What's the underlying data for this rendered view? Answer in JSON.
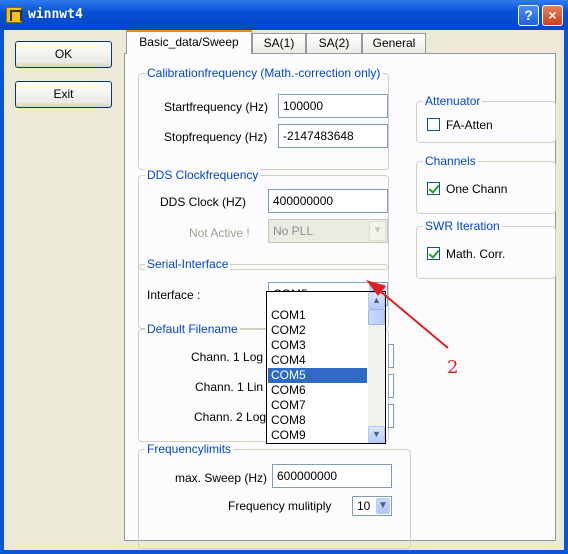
{
  "window": {
    "title": "winnwt4",
    "help_label": "?",
    "close_label": "×"
  },
  "buttons": {
    "ok": "OK",
    "exit": "Exit"
  },
  "tabs": [
    {
      "label": "Basic_data/Sweep",
      "active": true
    },
    {
      "label": "SA(1)",
      "active": false
    },
    {
      "label": "SA(2)",
      "active": false
    },
    {
      "label": "General",
      "active": false
    }
  ],
  "calibration": {
    "title": "Calibrationfrequency (Math.-correction only)",
    "start_label": "Startfrequency (Hz)",
    "start_value": "100000",
    "stop_label": "Stopfrequency (Hz)",
    "stop_value": "-2147483648"
  },
  "dds": {
    "title": "DDS Clockfrequency",
    "clock_label": "DDS Clock (HZ)",
    "clock_value": "400000000",
    "pll_label": "Not Active !",
    "pll_value": "No PLL"
  },
  "serial": {
    "title": "Serial-Interface",
    "interface_label": "Interface :",
    "interface_value": "COM5",
    "options": [
      "COM1",
      "COM2",
      "COM3",
      "COM4",
      "COM5",
      "COM6",
      "COM7",
      "COM8",
      "COM9"
    ],
    "selected_index": 4
  },
  "default_filename": {
    "title": "Default Filename",
    "chann1_log": "Chann. 1  Log",
    "chann1_lin": "Chann. 1  Lin",
    "chann2_log": "Chann. 2 Log"
  },
  "frequencylimits": {
    "title": "Frequencylimits",
    "max_sweep_label": "max. Sweep (Hz)",
    "max_sweep_value": "600000000",
    "multiply_label": "Frequency mulitiply",
    "multiply_value": "10"
  },
  "attenuator": {
    "title": "Attenuator",
    "fa_label": "FA-Atten",
    "fa_checked": false
  },
  "channels": {
    "title": "Channels",
    "one_label": "One Chann",
    "one_checked": true
  },
  "swr": {
    "title": "SWR Iteration",
    "math_label": "Math. Corr.",
    "math_checked": true
  },
  "annotation": {
    "number": "2",
    "color": "#e02020"
  }
}
